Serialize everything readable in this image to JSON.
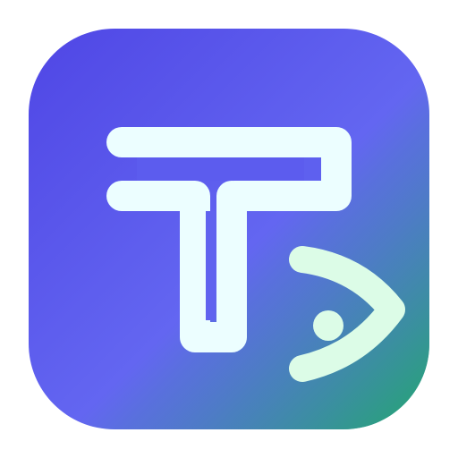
{
  "app_icon": {
    "name": "app-logo",
    "colors": {
      "gradient_start": "#4F46E5",
      "gradient_mid": "#6366F1",
      "gradient_end": "#22A86E",
      "glyph_fill": "#ECFEFF",
      "eye_fill": "#DCFCE7"
    },
    "icons": [
      "t-letter-icon",
      "eye-icon"
    ]
  }
}
